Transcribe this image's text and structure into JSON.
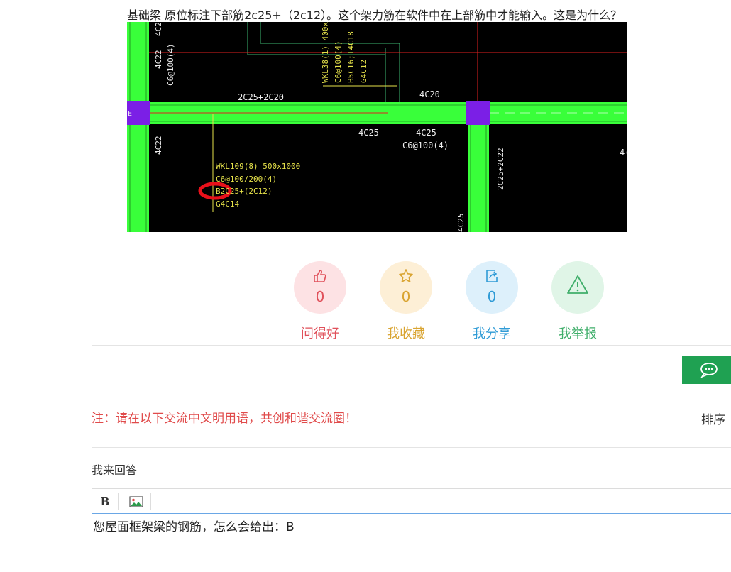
{
  "question": {
    "text": "基础梁  原位标注下部筋2c25+（2c12）。这个架力筋在软件中在上部筋中才能输入。这是为什么？"
  },
  "drawing": {
    "labels": {
      "left_col_top_a": "4C2",
      "left_col_top_b": "4C22",
      "left_col_top_c": "C6@100(4)",
      "left_col_bottom": "4C22",
      "wkl38_a": "WKL38(1) 400x1",
      "wkl38_b": "C6@100(4)",
      "wkl38_c": "B5C16;T4C18",
      "wkl38_d": "G4C12",
      "beam_top_left": "2C25+2C20",
      "beam_top_right": "4C20",
      "beam_bot_a": "4C25",
      "beam_bot_b": "4C25",
      "beam_bot_c": "C6@100(4)",
      "wkl109_a": "WKL109(8) 500x1000",
      "wkl109_b": "C6@100/200(4)",
      "wkl109_c": "B2C25+(2C12)",
      "wkl109_d": "G4C14",
      "right_col": "2C25+2C22",
      "right_col_bottom": "4C25",
      "edge_right": "4(",
      "edge_left": "E"
    }
  },
  "actions": [
    {
      "icon": "thumbs-up-icon",
      "count": "0",
      "label": "问得好",
      "color": "#e0505a",
      "bg": "#fde2e4"
    },
    {
      "icon": "star-icon",
      "count": "0",
      "label": "我收藏",
      "color": "#d9a431",
      "bg": "#fdefd6"
    },
    {
      "icon": "share-icon",
      "count": "0",
      "label": "我分享",
      "color": "#2f9bd6",
      "bg": "#ddf0fb"
    },
    {
      "icon": "warning-icon",
      "count": "",
      "label": "我举报",
      "color": "#3fae6a",
      "bg": "#e0f5e7"
    }
  ],
  "notice": "注：请在以下交流中文明用语，共创和谐交流圈！",
  "sort_label": "排序",
  "answer_title": "我来回答",
  "editor": {
    "bold_label": "B",
    "content": "您屋面框架梁的钢筋，怎么会给出：B"
  }
}
